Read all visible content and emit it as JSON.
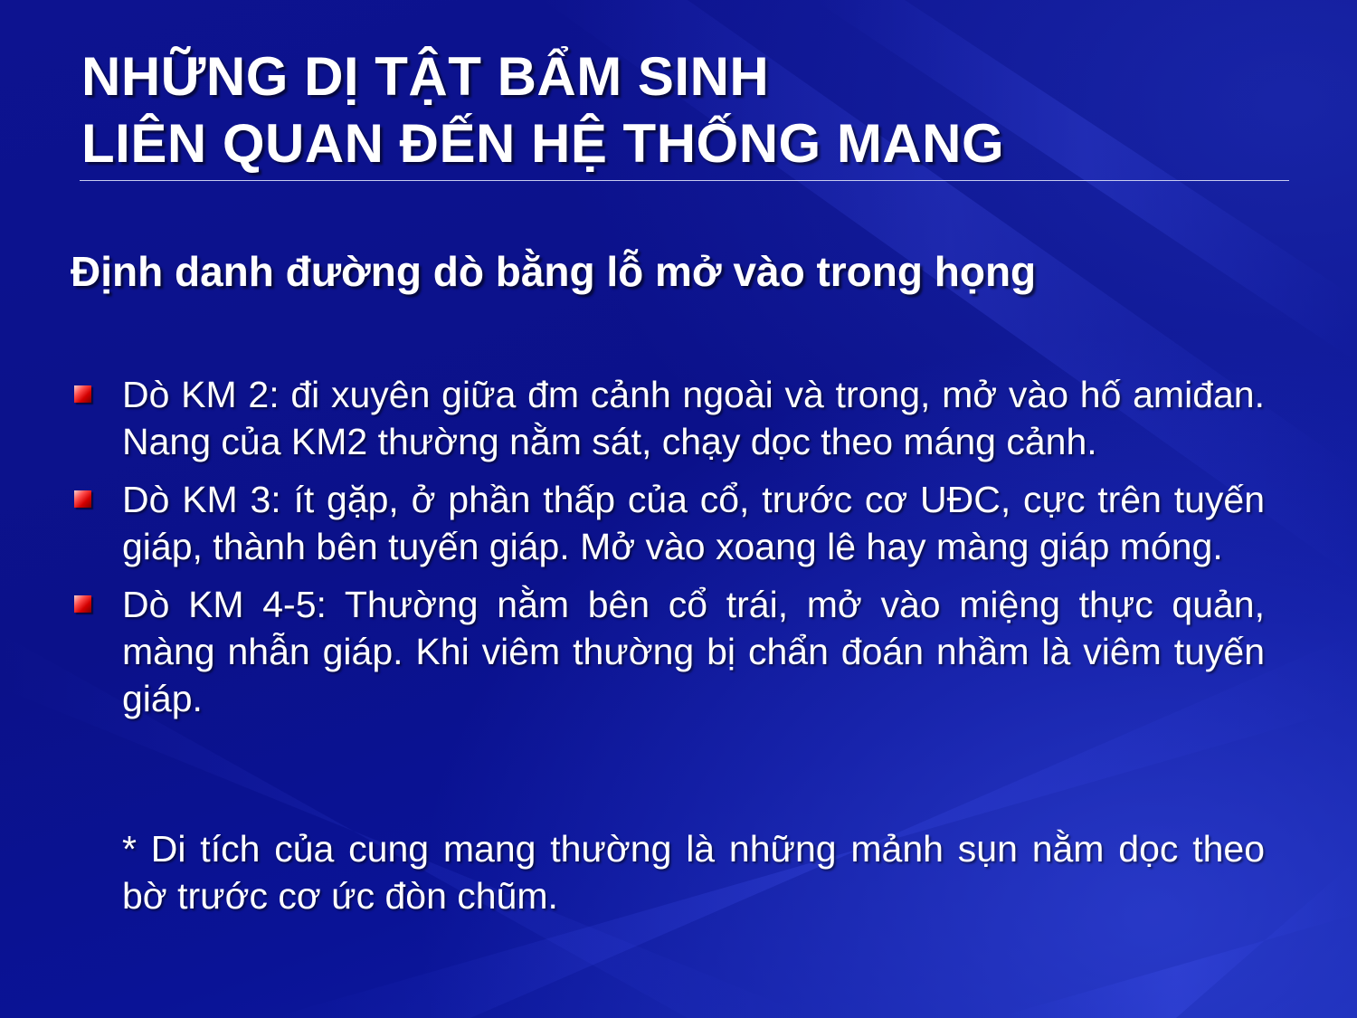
{
  "slide": {
    "title_lines": [
      "NHỮNG DỊ TẬT BẨM SINH",
      "LIÊN QUAN ĐẾN HỆ THỐNG MANG"
    ],
    "subtitle": "Định danh đường dò bằng lỗ mở vào trong họng",
    "bullets": [
      "Dò KM 2: đi xuyên giữa đm cảnh ngoài và trong, mở vào hố amiđan. Nang của KM2 thường nằm sát, chạy dọc theo máng cảnh.",
      "Dò KM 3: ít gặp, ở phần thấp của cổ, trước cơ UĐC, cực trên tuyến giáp, thành bên tuyến giáp. Mở vào xoang lê hay màng giáp móng.",
      "Dò KM 4-5: Thường nằm bên cổ trái, mở vào miệng thực quản, màng nhẫn giáp. Khi viêm thường bị chẩn đoán nhầm là viêm tuyến giáp."
    ],
    "note": "* Di tích của cung mang thường là những mảnh sụn nằm dọc theo bờ trước cơ ức đòn chũm.",
    "colors": {
      "background": "#0b118a",
      "text": "#ffffff",
      "bullet": "#e01010",
      "rule": "#c8ccf0"
    },
    "bullet_icon": "red-square-bullet-icon"
  }
}
